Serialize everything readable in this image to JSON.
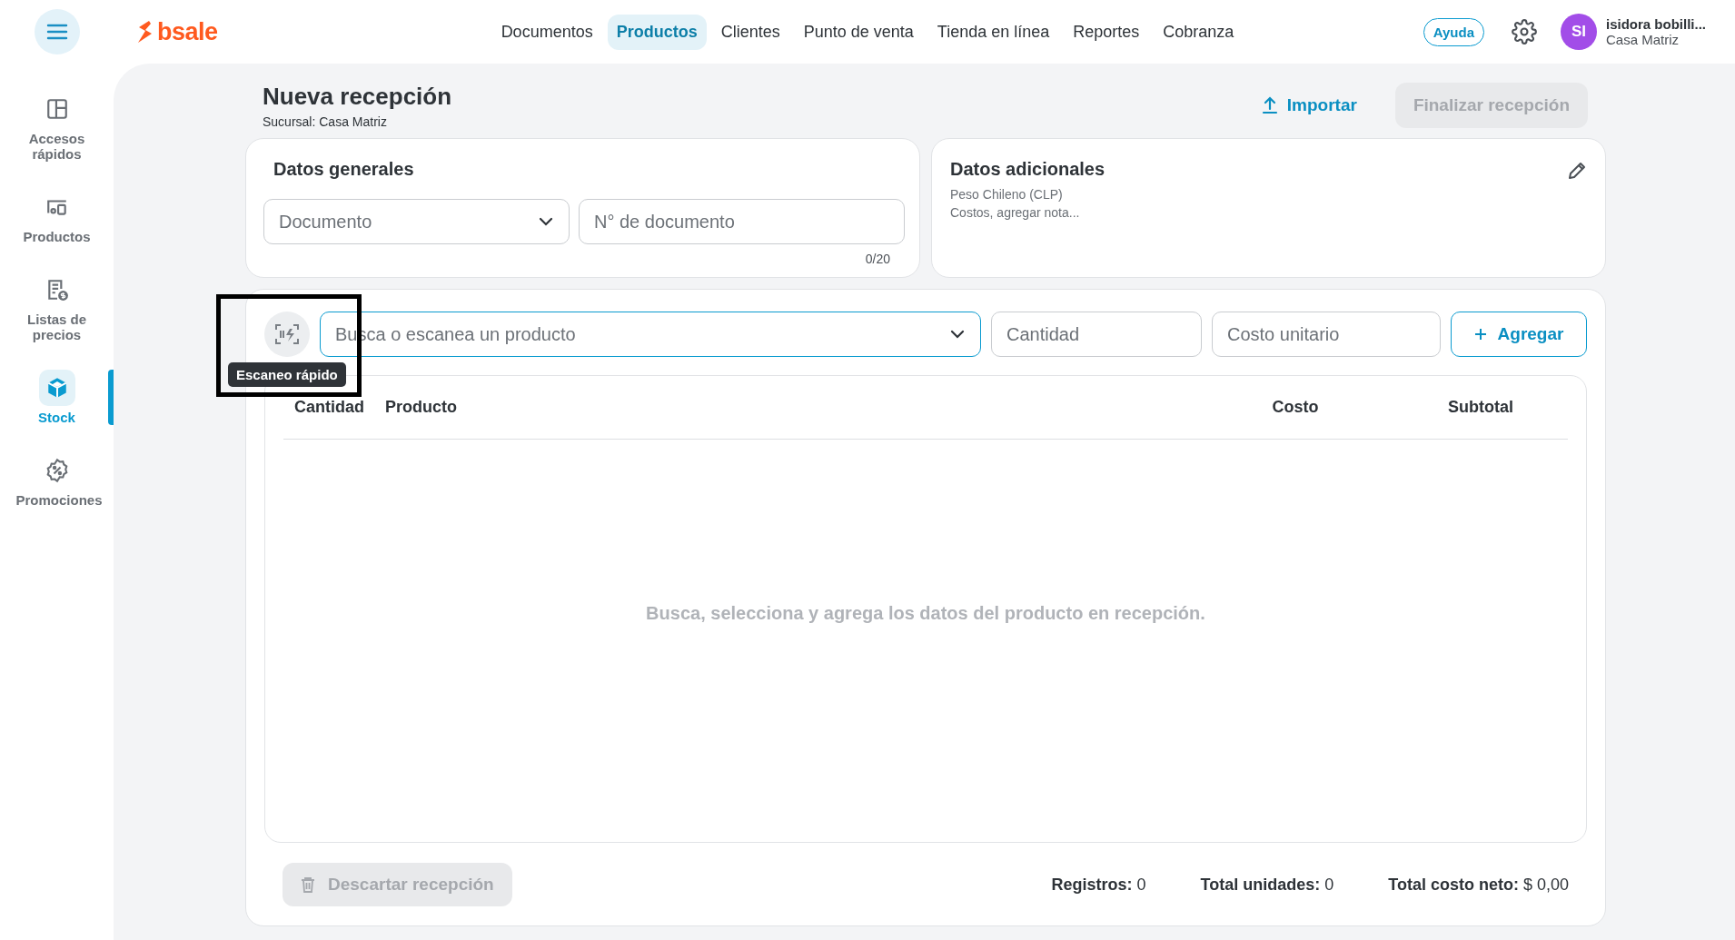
{
  "topbar": {
    "logo": "bsale",
    "nav": [
      {
        "label": "Documentos",
        "selected": false
      },
      {
        "label": "Productos",
        "selected": true
      },
      {
        "label": "Clientes",
        "selected": false
      },
      {
        "label": "Punto de venta",
        "selected": false
      },
      {
        "label": "Tienda en línea",
        "selected": false
      },
      {
        "label": "Reportes",
        "selected": false
      },
      {
        "label": "Cobranza",
        "selected": false
      }
    ],
    "help": "Ayuda",
    "user": {
      "initials": "SI",
      "name": "isidora bobilli...",
      "branch": "Casa Matriz"
    }
  },
  "sidebar": {
    "items": [
      {
        "label": "Accesos rápidos",
        "kind": "layout",
        "selected": false
      },
      {
        "label": "Productos",
        "kind": "devices",
        "selected": false
      },
      {
        "label": "Listas de precios",
        "kind": "pricelist",
        "selected": false
      },
      {
        "label": "Stock",
        "kind": "cube",
        "selected": true
      },
      {
        "label": "Promociones",
        "kind": "promo",
        "selected": false
      }
    ]
  },
  "header": {
    "title": "Nueva recepción",
    "subtitle": "Sucursal: Casa Matriz",
    "import": "Importar",
    "finish": {
      "label": "Finalizar recepción",
      "disabled": true
    }
  },
  "general": {
    "title": "Datos generales",
    "document": {
      "placeholder": "Documento"
    },
    "number": {
      "placeholder": "N° de documento",
      "counter": "0/20"
    }
  },
  "additional": {
    "title": "Datos adicionales",
    "lines": [
      "Peso Chileno (CLP)",
      "Costos, agregar nota..."
    ]
  },
  "entry": {
    "scan_tooltip": "Escaneo rápido",
    "highlighted": true,
    "search": {
      "placeholder": "Busca o escanea un producto"
    },
    "quantity": {
      "placeholder": "Cantidad"
    },
    "cost": {
      "placeholder": "Costo unitario"
    },
    "add": "Agregar"
  },
  "table": {
    "columns": [
      "Cantidad",
      "Producto",
      "Costo",
      "Subtotal"
    ],
    "empty": "Busca, selecciona y agrega los datos del producto en recepción."
  },
  "footer": {
    "discard": {
      "label": "Descartar recepción",
      "disabled": true
    },
    "totals": [
      {
        "label": "Registros:",
        "value": "0"
      },
      {
        "label": "Total unidades:",
        "value": "0"
      },
      {
        "label": "Total costo neto:",
        "value": "$ 0,00"
      }
    ]
  }
}
